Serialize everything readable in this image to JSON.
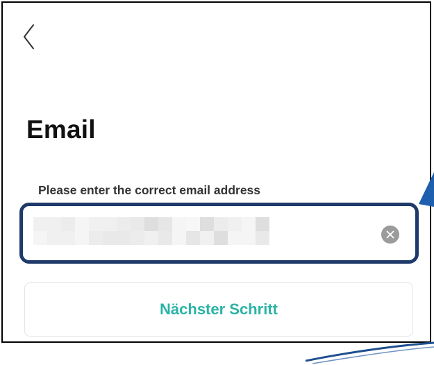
{
  "header": {
    "back_icon": "chevron-left-icon"
  },
  "page": {
    "title": "Email"
  },
  "email_field": {
    "label": "Please enter the correct email address",
    "value": "",
    "masked": true,
    "clear_icon": "clear-circle-icon"
  },
  "actions": {
    "next_label": "Nächster Schritt"
  },
  "colors": {
    "highlight_border": "#1f3a6a",
    "accent_teal": "#2ab3a6",
    "arrow_blue": "#1e5fae"
  }
}
